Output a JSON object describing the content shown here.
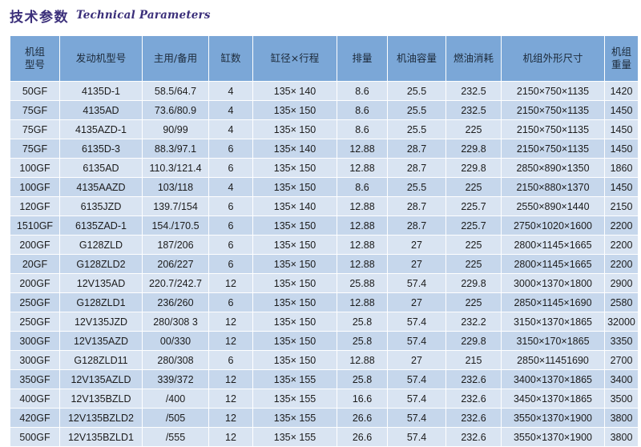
{
  "title": {
    "chinese": "技术参数",
    "english": "Technical Parameters",
    "color": "#3b2f7a"
  },
  "theme": {
    "header_bg": "#7ba7d7",
    "row_bg_light": "#d9e4f2",
    "row_bg_dark": "#c6d7ec",
    "page_bg": "#ffffff",
    "text_color": "#1b1b1b"
  },
  "table": {
    "columns": [
      {
        "key": "unit_model",
        "label_line1": "机组",
        "label_line2": "型号"
      },
      {
        "key": "engine_model",
        "label_line1": "发动机型号",
        "label_line2": ""
      },
      {
        "key": "prime_standby",
        "label_line1": "主用/备用",
        "label_line2": ""
      },
      {
        "key": "cylinders",
        "label_line1": "缸数",
        "label_line2": ""
      },
      {
        "key": "bore_stroke",
        "label_line1": "缸径×行程",
        "label_line2": ""
      },
      {
        "key": "displacement",
        "label_line1": "排量",
        "label_line2": ""
      },
      {
        "key": "oil_capacity",
        "label_line1": "机油容量",
        "label_line2": ""
      },
      {
        "key": "fuel_consumption",
        "label_line1": "燃油消耗",
        "label_line2": ""
      },
      {
        "key": "dimensions",
        "label_line1": "机组外形尺寸",
        "label_line2": ""
      },
      {
        "key": "weight",
        "label_line1": "机组",
        "label_line2": "重量"
      }
    ],
    "rows": [
      [
        "50GF",
        "4135D-1",
        "58.5/64.7",
        "4",
        "135× 140",
        "8.6",
        "25.5",
        "232.5",
        "2150×750×1135",
        "1420"
      ],
      [
        "75GF",
        "4135AD",
        "73.6/80.9",
        "4",
        "135× 150",
        "8.6",
        "25.5",
        "232.5",
        "2150×750×1135",
        "1450"
      ],
      [
        "75GF",
        "4135AZD-1",
        "90/99",
        "4",
        "135× 150",
        "8.6",
        "25.5",
        "225",
        "2150×750×1135",
        "1450"
      ],
      [
        "75GF",
        "6135D-3",
        "88.3/97.1",
        "6",
        "135× 140",
        "12.88",
        "28.7",
        "229.8",
        "2150×750×1135",
        "1450"
      ],
      [
        "100GF",
        "6135AD",
        "110.3/121.4",
        "6",
        "135× 150",
        "12.88",
        "28.7",
        "229.8",
        "2850×890×1350",
        "1860"
      ],
      [
        "100GF",
        "4135AAZD",
        "103/118",
        "4",
        "135× 150",
        "8.6",
        "25.5",
        "225",
        "2150×880×1370",
        "1450"
      ],
      [
        "120GF",
        "6135JZD",
        "139.7/154",
        "6",
        "135× 140",
        "12.88",
        "28.7",
        "225.7",
        "2550×890×1440",
        "2150"
      ],
      [
        "1510GF",
        "6135ZAD-1",
        "154./170.5",
        "6",
        "135× 150",
        "12.88",
        "28.7",
        "225.7",
        "2750×1020×1600",
        "2200"
      ],
      [
        "200GF",
        "G128ZLD",
        "187/206",
        "6",
        "135× 150",
        "12.88",
        "27",
        "225",
        "2800×1145×1665",
        "2200"
      ],
      [
        "20GF",
        "G128ZLD2",
        "206/227",
        "6",
        "135× 150",
        "12.88",
        "27",
        "225",
        "2800×1145×1665",
        "2200"
      ],
      [
        "200GF",
        "12V135AD",
        "220.7/242.7",
        "12",
        "135× 150",
        "25.88",
        "57.4",
        "229.8",
        "3000×1370×1800",
        "2900"
      ],
      [
        "250GF",
        "G128ZLD1",
        "236/260",
        "6",
        "135× 150",
        "12.88",
        "27",
        "225",
        "2850×1145×1690",
        "2580"
      ],
      [
        "250GF",
        "12V135JZD",
        "280/308  3",
        "12",
        "135× 150",
        "25.8",
        "57.4",
        "232.2",
        "3150×1370×1865",
        "32000"
      ],
      [
        "300GF",
        "12V135AZD",
        "00/330",
        "12",
        "135× 150",
        "25.8",
        "57.4",
        "229.8",
        "3150×170×1865",
        "3350"
      ],
      [
        "300GF",
        "G128ZLD11",
        "280/308",
        "6",
        "135× 150",
        "12.88",
        "27",
        "215",
        "2850×11451690",
        "2700"
      ],
      [
        "350GF",
        "12V135AZLD",
        "339/372",
        "12",
        "135× 155",
        "25.8",
        "57.4",
        "232.6",
        "3400×1370×1865",
        "3400"
      ],
      [
        "400GF",
        "12V135BZLD",
        "/400",
        "12",
        "135× 155",
        "16.6",
        "57.4",
        "232.6",
        "3450×1370×1865",
        "3500"
      ],
      [
        "420GF",
        "12V135BZLD2",
        "/505",
        "12",
        "135× 155",
        "26.6",
        "57.4",
        "232.6",
        "3550×1370×1900",
        "3800"
      ],
      [
        "500GF",
        "12V135BZLD1",
        "/555",
        "12",
        "135× 155",
        "26.6",
        "57.4",
        "232.6",
        "3550×1370×1900",
        "3800"
      ]
    ],
    "left_aligned_cells": [
      [
        16,
        2
      ],
      [
        17,
        2
      ],
      [
        18,
        2
      ]
    ]
  }
}
